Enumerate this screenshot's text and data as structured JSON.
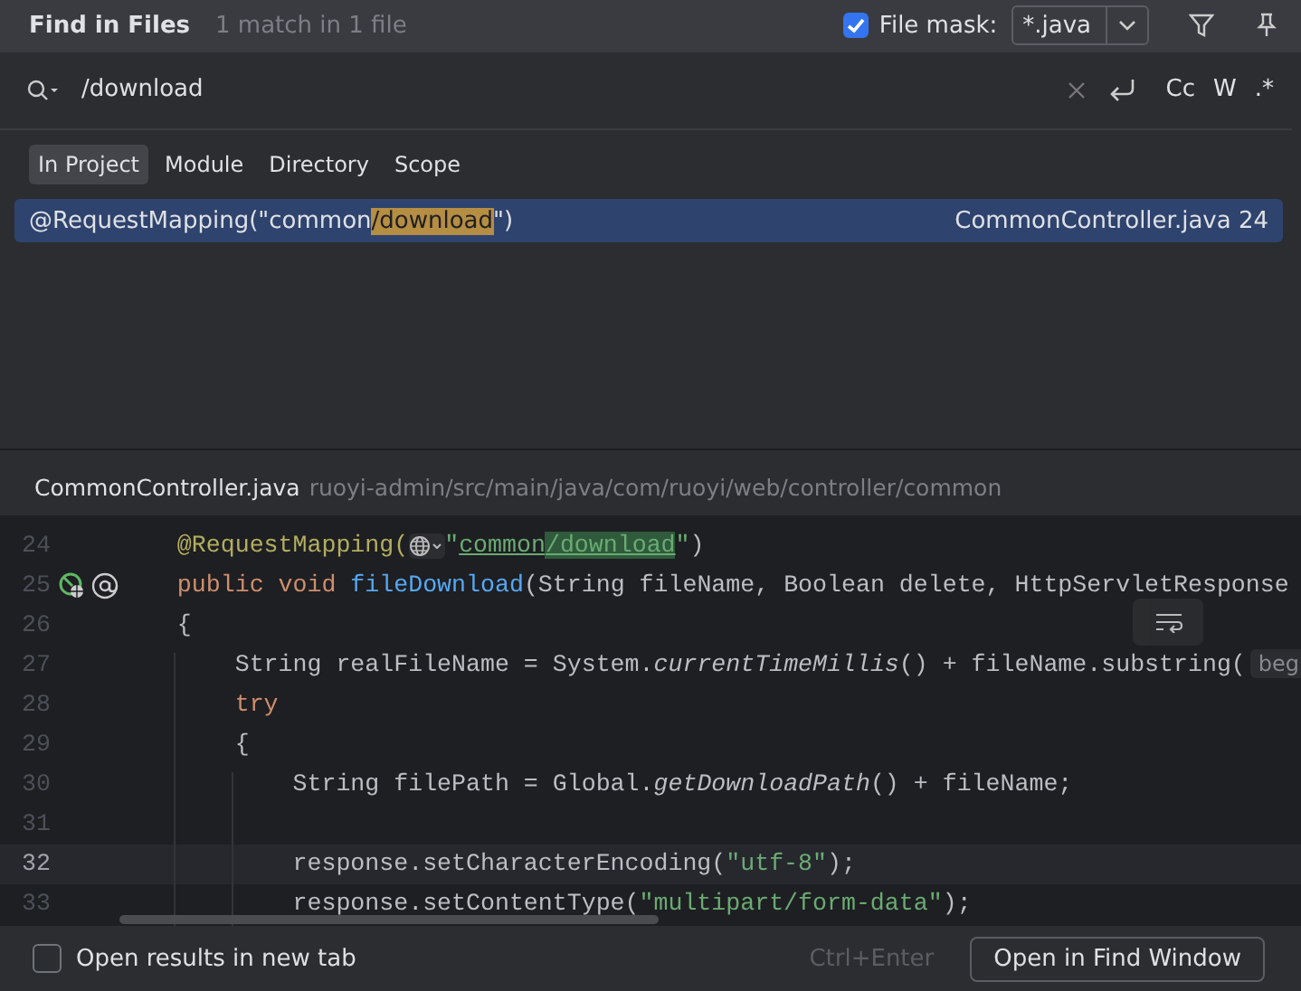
{
  "header": {
    "title": "Find in Files",
    "summary": "1 match in 1 file",
    "file_mask": {
      "label": "File mask:",
      "checked": true,
      "value": "*.java"
    }
  },
  "search": {
    "value": "/download",
    "toggles": [
      "Cc",
      "W",
      ".*"
    ]
  },
  "scopes": [
    {
      "label": "In Project",
      "selected": true
    },
    {
      "label": "Module",
      "selected": false
    },
    {
      "label": "Directory",
      "selected": false
    },
    {
      "label": "Scope",
      "selected": false
    }
  ],
  "results": [
    {
      "before": "@RequestMapping(\"common",
      "match": "/download",
      "after": "\")",
      "location": "CommonController.java 24",
      "selected": true
    }
  ],
  "preview": {
    "file": "CommonController.java",
    "path": "ruoyi-admin/src/main/java/com/ruoyi/web/controller/common",
    "lines": [
      {
        "number": "24",
        "current": false,
        "tokens": [
          {
            "kind": "annotation",
            "text": "    @RequestMapping("
          },
          {
            "kind": "url-hint"
          },
          {
            "kind": "string",
            "text": "\""
          },
          {
            "kind": "link",
            "text": "common"
          },
          {
            "kind": "match",
            "text": "/download"
          },
          {
            "kind": "string",
            "text": "\""
          },
          {
            "kind": "plain",
            "text": ")"
          }
        ]
      },
      {
        "number": "25",
        "current": false,
        "endpoint_icon": true,
        "annotation_icon": true,
        "tokens": [
          {
            "kind": "keyword",
            "text": "    public void "
          },
          {
            "kind": "function",
            "text": "fileDownload"
          },
          {
            "kind": "plain",
            "text": "(String fileName, Boolean delete, HttpServletResponse"
          }
        ]
      },
      {
        "number": "26",
        "current": false,
        "tokens": [
          {
            "kind": "plain",
            "text": "    {"
          }
        ]
      },
      {
        "number": "27",
        "current": false,
        "tokens": [
          {
            "kind": "plain",
            "text": "        String realFileName = System."
          },
          {
            "kind": "italic",
            "text": "currentTimeMillis"
          },
          {
            "kind": "plain",
            "text": "() + fileName.substring("
          },
          {
            "kind": "hint",
            "text": "beg"
          }
        ]
      },
      {
        "number": "28",
        "current": false,
        "tokens": [
          {
            "kind": "keyword",
            "text": "        try"
          }
        ]
      },
      {
        "number": "29",
        "current": false,
        "tokens": [
          {
            "kind": "plain",
            "text": "        {"
          }
        ]
      },
      {
        "number": "30",
        "current": false,
        "tokens": [
          {
            "kind": "plain",
            "text": "            String filePath = Global."
          },
          {
            "kind": "italic",
            "text": "getDownloadPath"
          },
          {
            "kind": "plain",
            "text": "() + fileName;"
          }
        ]
      },
      {
        "number": "31",
        "current": false
      },
      {
        "number": "32",
        "current": true,
        "tokens": [
          {
            "kind": "plain",
            "text": "            response.setCharacterEncoding("
          },
          {
            "kind": "string",
            "text": "\"utf-8\""
          },
          {
            "kind": "plain",
            "text": ");"
          }
        ]
      },
      {
        "number": "33",
        "current": false,
        "tokens": [
          {
            "kind": "plain",
            "text": "            response.setContentType("
          },
          {
            "kind": "string",
            "text": "\"multipart/form-data\""
          },
          {
            "kind": "plain",
            "text": ");"
          }
        ]
      }
    ]
  },
  "footer": {
    "new_tab": {
      "label": "Open results in new tab",
      "checked": false
    },
    "shortcut": "Ctrl+Enter",
    "button": "Open in Find Window"
  }
}
